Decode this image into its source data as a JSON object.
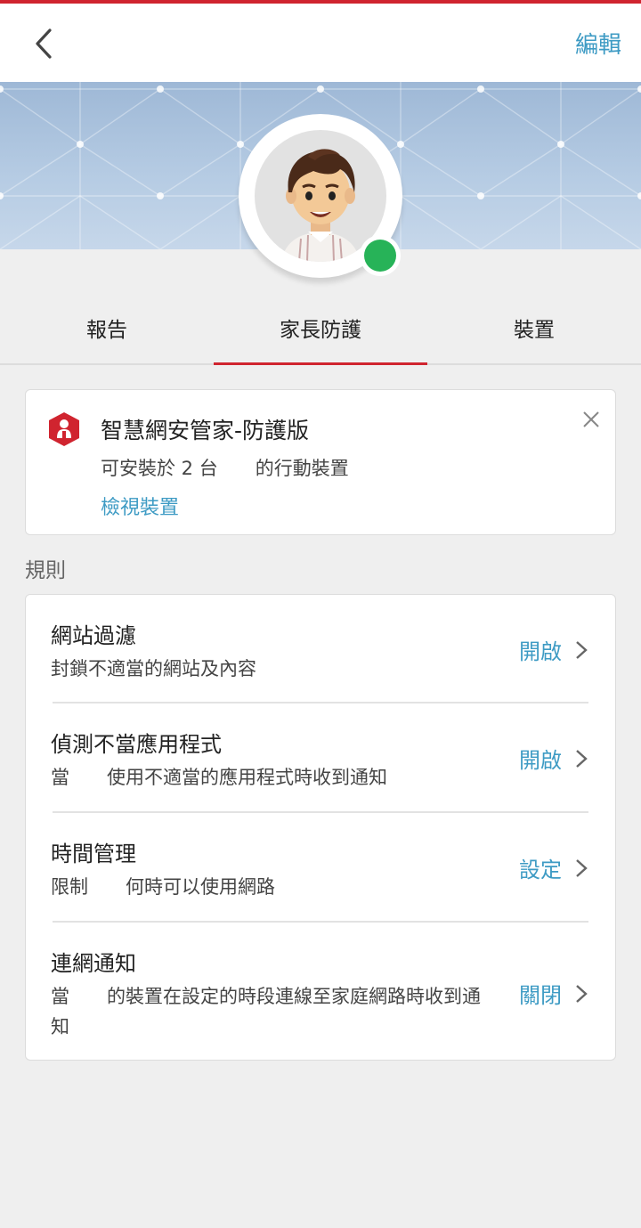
{
  "header": {
    "back_icon": "chevron-left-icon",
    "edit_label": "編輯"
  },
  "profile": {
    "status_color": "#27b358"
  },
  "tabs": [
    {
      "label": "報告"
    },
    {
      "label": "家長防護"
    },
    {
      "label": "裝置"
    }
  ],
  "promo": {
    "title": "智慧網安管家-防護版",
    "subtitle": "可安裝於 2 台　　的行動裝置",
    "link": "檢視裝置",
    "close_icon": "close-icon"
  },
  "rules_section": {
    "title": "規則",
    "items": [
      {
        "title": "網站過濾",
        "desc": "封鎖不適當的網站及內容",
        "state": "開啟"
      },
      {
        "title": "偵測不當應用程式",
        "desc": "當　　使用不適當的應用程式時收到通知",
        "state": "開啟"
      },
      {
        "title": "時間管理",
        "desc": "限制　　何時可以使用網路",
        "state": "設定"
      },
      {
        "title": "連網通知",
        "desc": "當　　的裝置在設定的時段連線至家庭網路時收到通知",
        "state": "關閉"
      }
    ]
  },
  "colors": {
    "accent": "#d0242f",
    "link": "#3e9bc4"
  }
}
